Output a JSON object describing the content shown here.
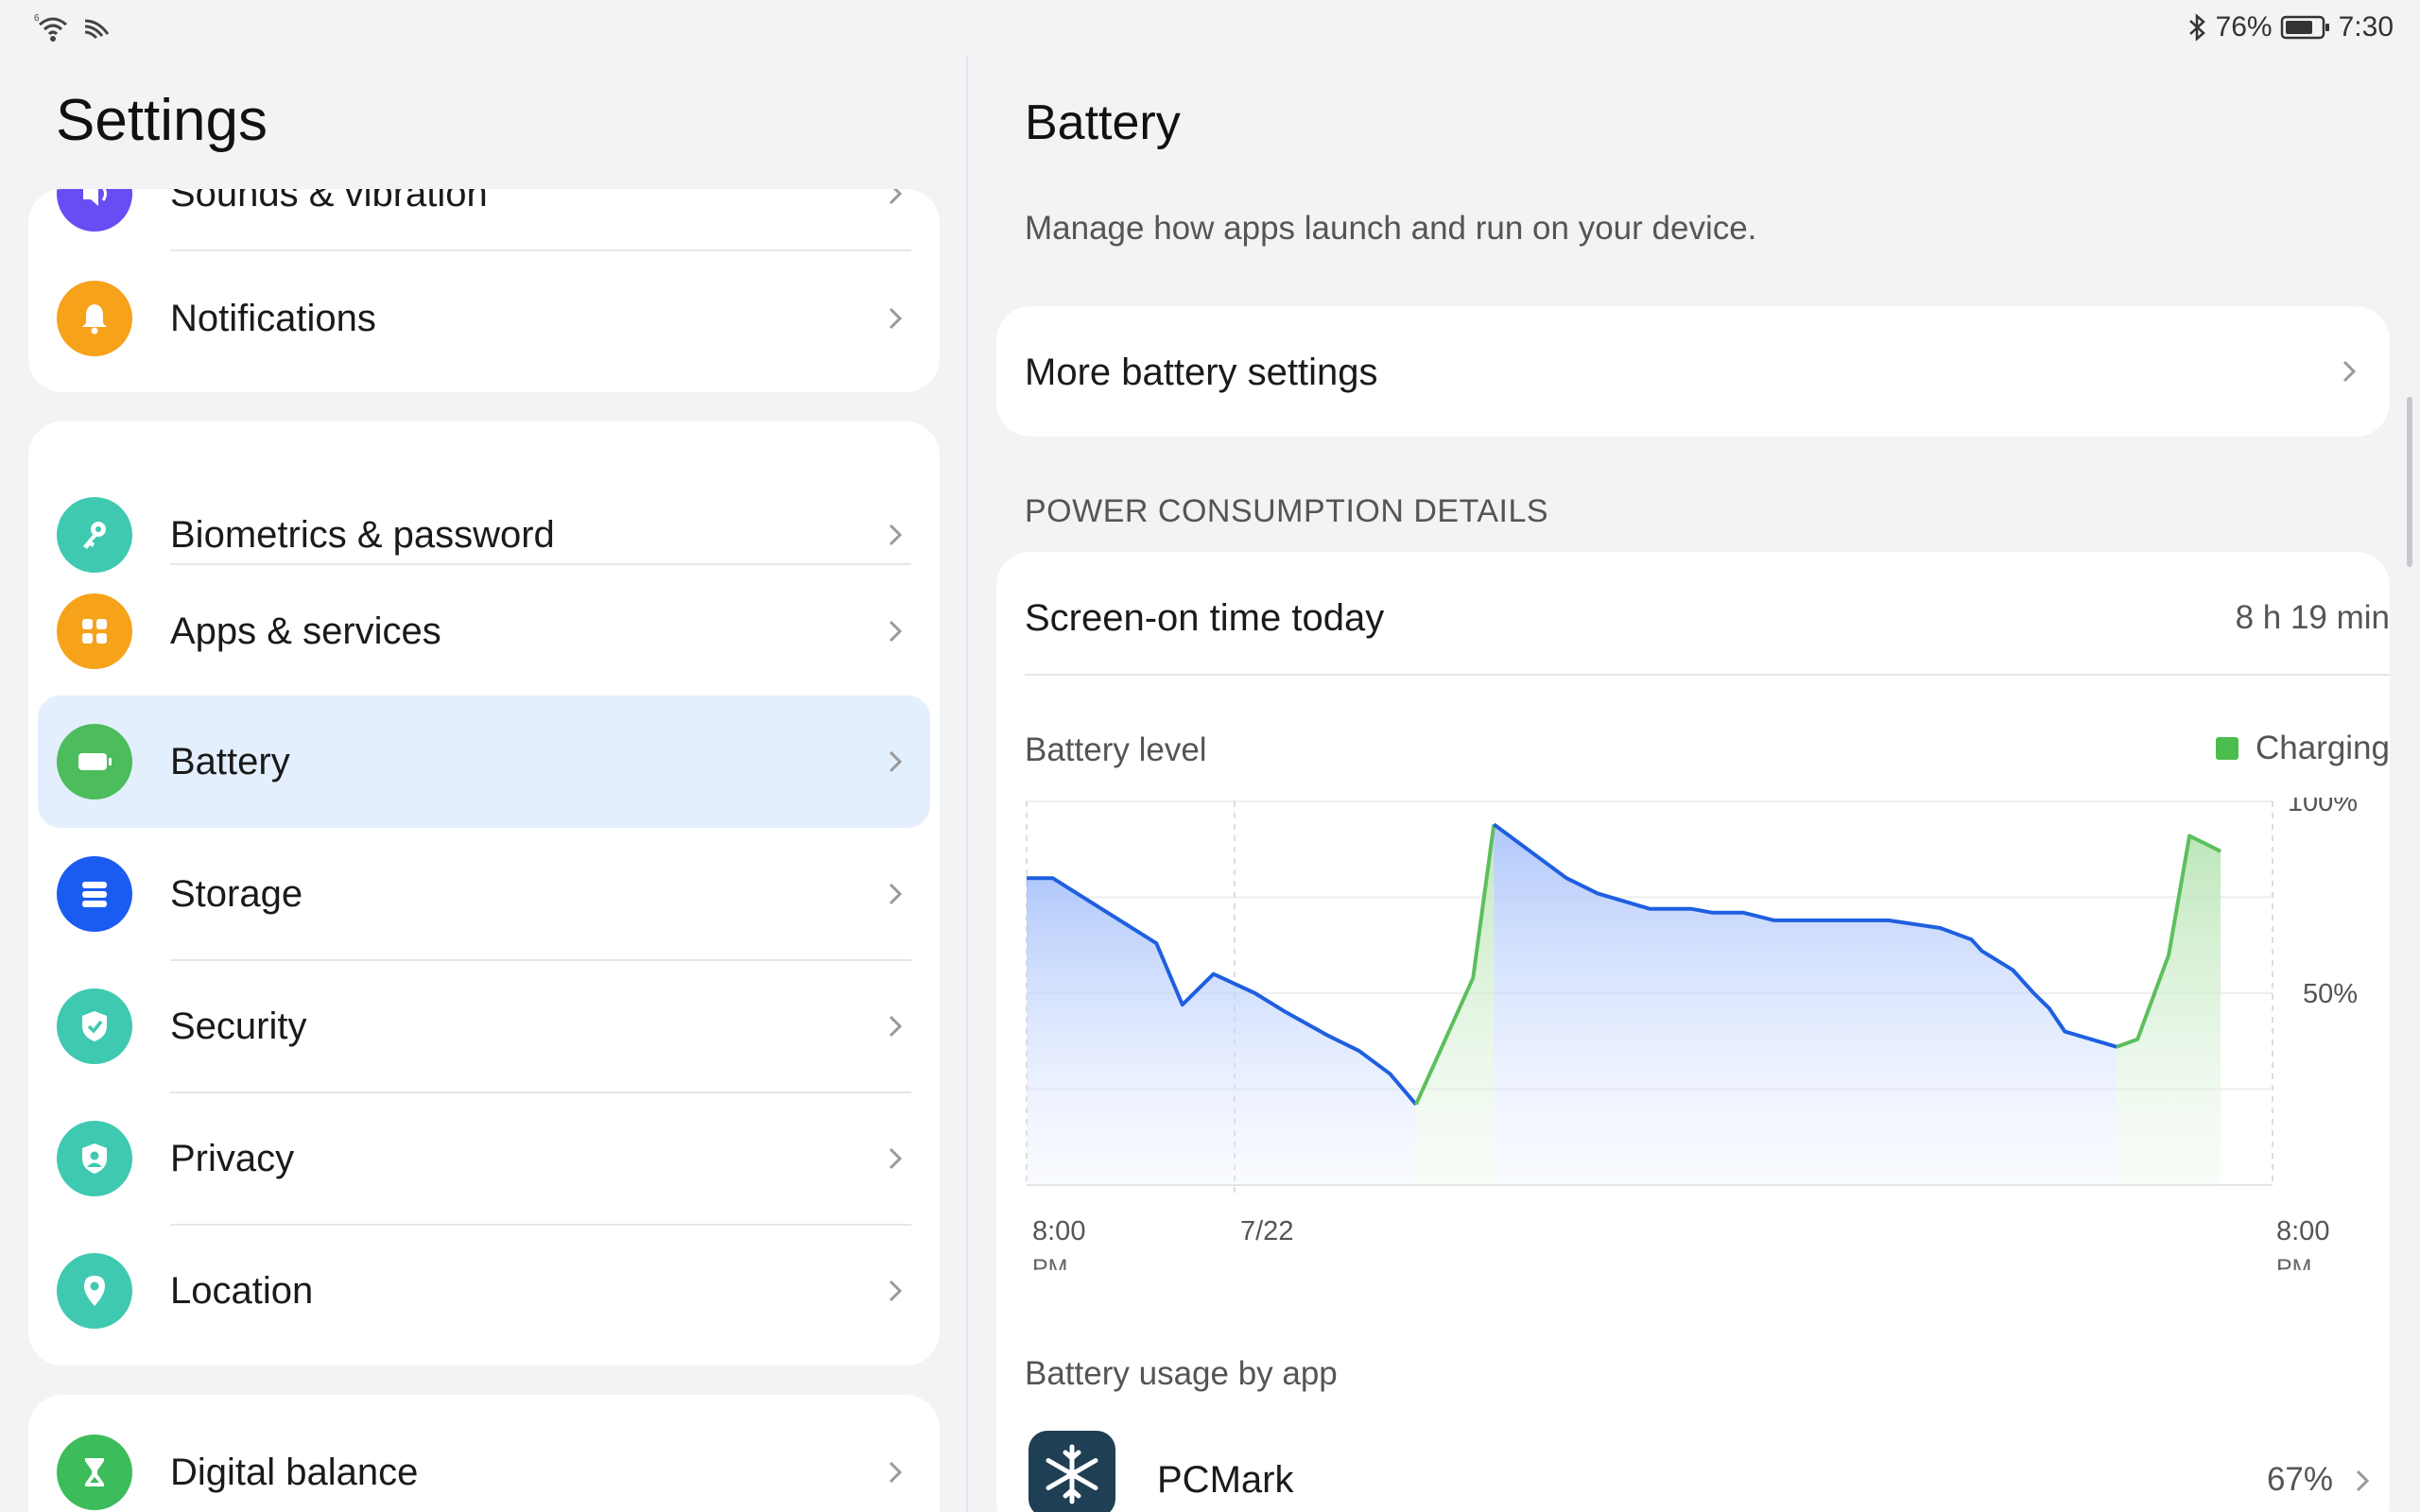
{
  "status_bar": {
    "battery_percent": "76%",
    "time": "7:30",
    "icons": [
      "wifi-icon",
      "hotspot-icon",
      "bluetooth-icon",
      "battery-icon"
    ]
  },
  "left": {
    "title": "Settings",
    "group1": [
      {
        "label": "Sounds & vibration",
        "icon": "sound-icon",
        "color": "#6a4cf5"
      },
      {
        "label": "Notifications",
        "icon": "bell-icon",
        "color": "#f7a21b"
      }
    ],
    "group2": [
      {
        "label": "Biometrics & password",
        "icon": "key-icon",
        "color": "#3fc9b0"
      },
      {
        "label": "Apps & services",
        "icon": "apps-grid-icon",
        "color": "#f7a21b"
      },
      {
        "label": "Battery",
        "icon": "battery-icon",
        "color": "#4cbc5c"
      },
      {
        "label": "Storage",
        "icon": "storage-icon",
        "color": "#1a5cf2"
      },
      {
        "label": "Security",
        "icon": "shield-check-icon",
        "color": "#3fc9b0"
      },
      {
        "label": "Privacy",
        "icon": "privacy-shield-icon",
        "color": "#3fc9b0"
      },
      {
        "label": "Location",
        "icon": "location-pin-icon",
        "color": "#3fc9b0"
      }
    ],
    "group3": [
      {
        "label": "Digital balance",
        "icon": "hourglass-icon",
        "color": "#3cbc5b"
      }
    ],
    "selected": "Battery",
    "selected_bg": "#e3effd"
  },
  "right": {
    "title": "Battery",
    "description": "Manage how apps launch and run on your device.",
    "more_settings": "More battery settings",
    "section_header": "POWER CONSUMPTION DETAILS",
    "screen_on_label": "Screen-on time today",
    "screen_on_value": "8 h 19 min",
    "battery_level_label": "Battery level",
    "legend_charging": "Charging",
    "usage_by_app": "Battery usage by app",
    "apps": [
      {
        "name": "PCMark",
        "percent": "67%",
        "icon": "snowflake-icon"
      }
    ]
  },
  "chart_data": {
    "type": "line",
    "series": [
      {
        "name": "Charging",
        "color": "#5cbf5c"
      }
    ],
    "discharge_color": "#1f5fe0",
    "charge_color": "#5cbf5c",
    "y_ticks": [
      "100%",
      "50%"
    ],
    "x_ticks": [
      {
        "line1": "8:00",
        "line2": "PM"
      },
      {
        "line1": "7/22",
        "line2": ""
      },
      {
        "line1": "8:00",
        "line2": "PM"
      }
    ],
    "ylim": [
      0,
      100
    ],
    "points": [
      [
        0,
        80
      ],
      [
        2.5,
        80
      ],
      [
        12.5,
        63
      ],
      [
        15,
        47
      ],
      [
        18,
        55
      ],
      [
        22,
        50
      ],
      [
        25,
        45
      ],
      [
        29,
        39
      ],
      [
        32,
        35
      ],
      [
        35,
        29
      ],
      [
        37.5,
        21
      ],
      [
        43,
        54
      ],
      [
        45,
        94
      ],
      [
        52,
        80
      ],
      [
        55,
        76
      ],
      [
        60,
        72
      ],
      [
        64,
        72
      ],
      [
        66,
        71
      ],
      [
        69,
        71
      ],
      [
        72,
        69
      ],
      [
        77,
        69
      ],
      [
        83,
        69
      ],
      [
        88,
        67
      ],
      [
        91,
        64
      ],
      [
        92,
        61
      ],
      [
        95,
        56
      ],
      [
        97,
        50
      ],
      [
        98.5,
        46
      ],
      [
        100,
        40
      ],
      [
        105,
        36
      ],
      [
        107,
        38
      ],
      [
        110,
        60
      ],
      [
        112,
        91
      ],
      [
        115,
        87
      ]
    ],
    "charging_ranges": [
      [
        37.5,
        45
      ],
      [
        105,
        115
      ]
    ],
    "x_domain": [
      0,
      120
    ]
  }
}
